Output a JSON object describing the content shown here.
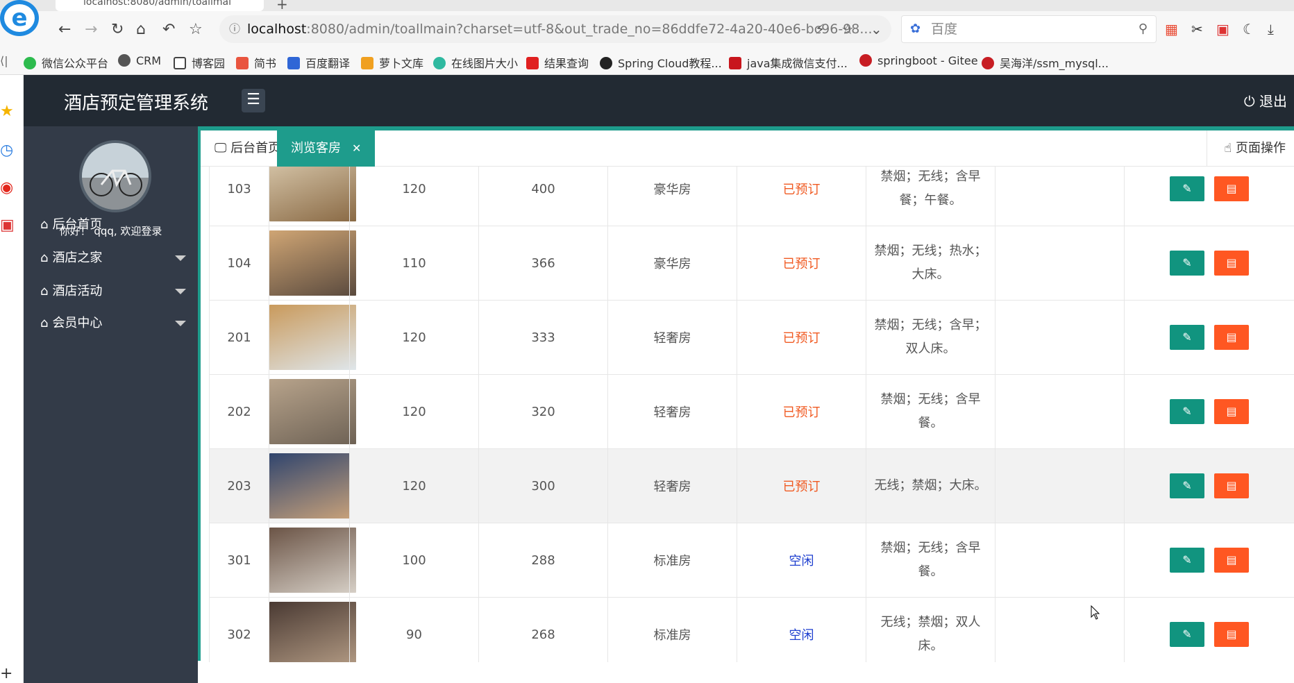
{
  "browser": {
    "tab_title": "localhost:8080/admin/toallmai",
    "url_host": "localhost",
    "url_rest": ":8080/admin/toallmain?charset=utf-8&out_trade_no=86ddfe72-4a20-40e6-bc96-98...",
    "search_placeholder": "百度",
    "bookmarks": [
      "微信公众平台",
      "CRM",
      "博客园",
      "简书",
      "百度翻译",
      "萝卜文库",
      "在线图片大小",
      "结果查询",
      "Spring Cloud教程...",
      "java集成微信支付...",
      "springboot - Gitee",
      "吴海洋/ssm_mysql..."
    ]
  },
  "header": {
    "title": "酒店预定管理系统",
    "logout": "退出"
  },
  "sidebar": {
    "welcome": "你好！ qqq, 欢迎登录",
    "items": [
      "后台首页",
      "酒店之家",
      "酒店活动",
      "会员中心"
    ]
  },
  "tabs": {
    "home": "后台首页",
    "current": "浏览客房",
    "page_ops": "页面操作"
  },
  "rooms": [
    {
      "no": "103",
      "area": "120",
      "price": "400",
      "type": "豪华房",
      "status": "已预订",
      "desc": "禁烟；无线；含早餐；午餐。",
      "thumb": [
        "#d9c9ad",
        "#8a6a45"
      ]
    },
    {
      "no": "104",
      "area": "110",
      "price": "366",
      "type": "豪华房",
      "status": "已预订",
      "desc": "禁烟；无线；热水；大床。",
      "thumb": [
        "#cfa574",
        "#5a4a3e"
      ]
    },
    {
      "no": "201",
      "area": "120",
      "price": "333",
      "type": "轻奢房",
      "status": "已预订",
      "desc": "禁烟；无线；含早；双人床。",
      "thumb": [
        "#c99a5c",
        "#dfe6ea"
      ]
    },
    {
      "no": "202",
      "area": "120",
      "price": "320",
      "type": "轻奢房",
      "status": "已预订",
      "desc": "禁烟；无线；含早餐。",
      "thumb": [
        "#b7a38b",
        "#6e6255"
      ]
    },
    {
      "no": "203",
      "area": "120",
      "price": "300",
      "type": "轻奢房",
      "status": "已预订",
      "desc": "无线；禁烟；大床。",
      "thumb": [
        "#30456e",
        "#c9a27a"
      ]
    },
    {
      "no": "301",
      "area": "100",
      "price": "288",
      "type": "标准房",
      "status": "空闲",
      "desc": "禁烟；无线；含早餐。",
      "thumb": [
        "#6b5446",
        "#d6cfc6"
      ]
    },
    {
      "no": "302",
      "area": "90",
      "price": "268",
      "type": "标准房",
      "status": "空闲",
      "desc": "无线；禁烟；双人床。",
      "thumb": [
        "#4a3a33",
        "#b39b84"
      ]
    }
  ]
}
